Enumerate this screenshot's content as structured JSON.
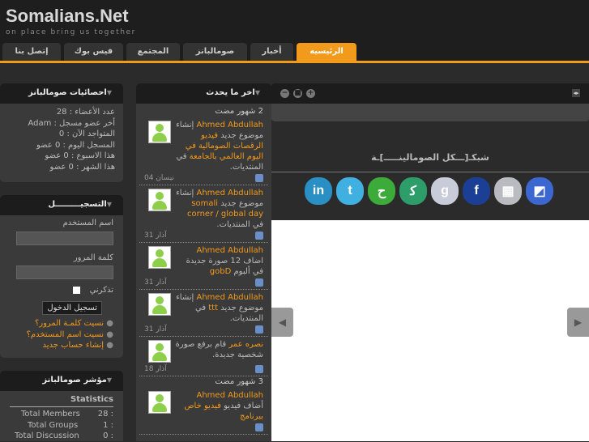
{
  "header": {
    "logo": "Somalians.Net",
    "tagline": "on place bring us together"
  },
  "nav": {
    "tabs": [
      "إتصل بنا",
      "فيس بوك",
      "المجتمع",
      "صومالبانز",
      "أخبار",
      "الرئيسيه"
    ],
    "active": "الرئيسيه"
  },
  "stats_panel": {
    "title": "احصائيات صومالبانز",
    "lines": [
      "عدد الأعضاء : 28",
      "أخر عضو مسجل : Adam",
      "المتواجد الآن : 0",
      "المسجل اليوم : 0 عضو",
      "هذا الاسبوع : 0 عضو",
      "هذا الشهر : 0 عضو"
    ]
  },
  "login_panel": {
    "title": "التسجيـــــــــل",
    "username_label": "اسم المستخدم",
    "password_label": "كلمة المرور",
    "remember_label": "تذكرني",
    "login_button": "تسجيل الدخول",
    "links": [
      "نسيت كلمـة المرور؟",
      "نسيت اسم المستخدم؟",
      "إنشاء حساب جديد"
    ]
  },
  "indicator_panel": {
    "title": "مؤشر صومالبانز",
    "subtitle": "Statistics",
    "rows": [
      {
        "label": "Total Members",
        "value": "28 :"
      },
      {
        "label": "Total Groups",
        "value": "1 :"
      },
      {
        "label": "Total Discussion",
        "value": "0 :"
      }
    ]
  },
  "feed": {
    "title": "اخر ما يحدث",
    "groups": [
      {
        "heading": "2 شهور مضت",
        "items": [
          {
            "user": "Ahmed Abdullah",
            "pre": "إنشاء موضوع جديد ",
            "link": "فيديو الرقصات الصومالية في اليوم العالمي بالجامعة",
            "post": " في المنتديات.",
            "date": "نيسان 04"
          },
          {
            "user": "Ahmed Abdullah",
            "pre": "إنشاء موضوع جديد ",
            "link": "somali corner / global day",
            "post": " في المنتديات.",
            "date": "آذار 31"
          },
          {
            "user": "Ahmed Abdullah",
            "pre": "اضاف 12 صورة جديدة في ألبوم ",
            "link": "gobD",
            "post": "",
            "date": "آذار 31"
          },
          {
            "user": "Ahmed Abdullah",
            "pre": "إنشاء موضوع جديد ",
            "link": "ttt",
            "post": " في المنتديات.",
            "date": "آذار 31"
          },
          {
            "user": "نصره عمر",
            "pre": "قام برفع صورة شخصية جديدة.",
            "link": "",
            "post": "",
            "date": "آذار 18"
          }
        ]
      },
      {
        "heading": "3 شهور مضت",
        "items": [
          {
            "user": "Ahmed Abdullah",
            "pre": "أضاف فيديو ",
            "link": "فيديو خاص ببرنامج",
            "post": "",
            "date": ""
          }
        ]
      }
    ]
  },
  "main": {
    "network_title": "شبكـ[ـــكل الصومالينـــــ]ـة",
    "social": [
      {
        "name": "linkedin",
        "glyph": "in",
        "color": "#2a8fc4"
      },
      {
        "name": "twitter",
        "glyph": "t",
        "color": "#3fb0e0"
      },
      {
        "name": "myspace",
        "glyph": "ح",
        "color": "#3dab3a"
      },
      {
        "name": "stumbleupon",
        "glyph": "ﮐ",
        "color": "#2d9e6a"
      },
      {
        "name": "google",
        "glyph": "g",
        "color": "#c8ccd8"
      },
      {
        "name": "facebook",
        "glyph": "f",
        "color": "#1b3f94"
      },
      {
        "name": "delicious-alt",
        "glyph": "▦",
        "color": "#b8bcc0"
      },
      {
        "name": "delicious",
        "glyph": "◩",
        "color": "#3c66d0"
      }
    ]
  }
}
